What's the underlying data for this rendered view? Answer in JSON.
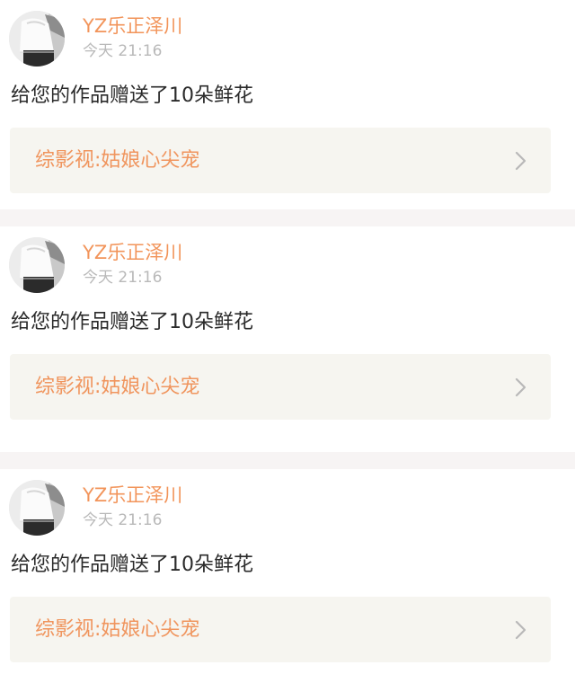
{
  "notifications": [
    {
      "username": "YZ乐正泽川",
      "time": "今天 21:16",
      "message": "给您的作品赠送了10朵鲜花",
      "work_title": "综影视:姑娘心尖宠"
    },
    {
      "username": "YZ乐正泽川",
      "time": "今天 21:16",
      "message": "给您的作品赠送了10朵鲜花",
      "work_title": "综影视:姑娘心尖宠"
    },
    {
      "username": "YZ乐正泽川",
      "time": "今天 21:16",
      "message": "给您的作品赠送了10朵鲜花",
      "work_title": "综影视:姑娘心尖宠"
    }
  ],
  "colors": {
    "username": "#f2945a",
    "timestamp": "#b9b9b9",
    "message": "#2a2a2a",
    "link_background": "#f6f5f0",
    "link_text": "#f0955e",
    "separator": "#f7f4f4"
  },
  "icons": {
    "avatar": "user-avatar-photo",
    "link_arrow": "chevron-right-icon"
  }
}
